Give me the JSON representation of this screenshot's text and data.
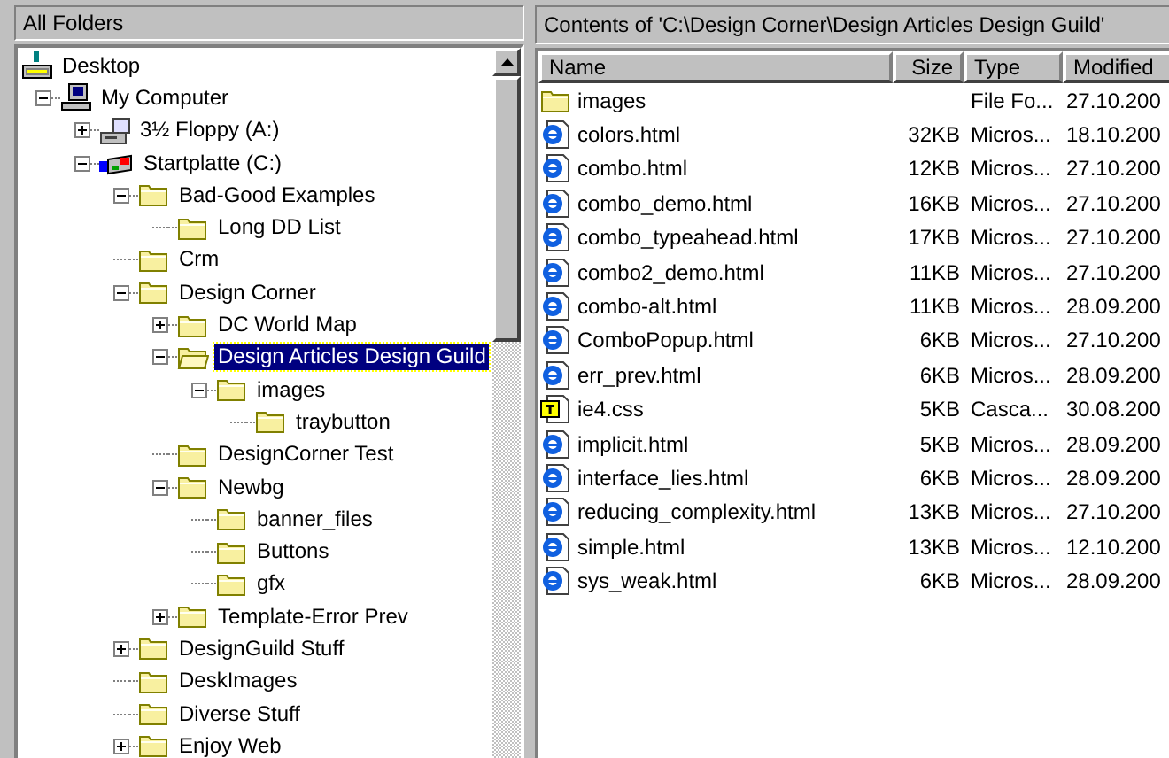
{
  "folders_pane": {
    "title": "All Folders",
    "tree": [
      {
        "label": "Desktop",
        "kind": "desktop",
        "selected": false,
        "children": [
          {
            "label": "My Computer",
            "kind": "computer",
            "selected": false,
            "expanded": true,
            "children": [
              {
                "label": "3½ Floppy (A:)",
                "kind": "floppy",
                "selected": false,
                "expanded": false
              },
              {
                "label": "Startplatte (C:)",
                "kind": "drive",
                "selected": false,
                "expanded": true,
                "children": [
                  {
                    "label": "Bad-Good Examples",
                    "kind": "folder",
                    "selected": false,
                    "expanded": true,
                    "children": [
                      {
                        "label": "Long DD List",
                        "kind": "folder",
                        "selected": false
                      }
                    ]
                  },
                  {
                    "label": "Crm",
                    "kind": "folder",
                    "selected": false
                  },
                  {
                    "label": "Design Corner",
                    "kind": "folder",
                    "selected": false,
                    "expanded": true,
                    "children": [
                      {
                        "label": "DC World Map",
                        "kind": "folder",
                        "selected": false,
                        "expanded": false
                      },
                      {
                        "label": "Design Articles Design Guild",
                        "kind": "folder",
                        "selected": true,
                        "expanded": true,
                        "children": [
                          {
                            "label": "images",
                            "kind": "folder",
                            "selected": false,
                            "expanded": true,
                            "children": [
                              {
                                "label": "traybutton",
                                "kind": "folder",
                                "selected": false
                              }
                            ]
                          }
                        ]
                      },
                      {
                        "label": "DesignCorner Test",
                        "kind": "folder",
                        "selected": false
                      },
                      {
                        "label": "Newbg",
                        "kind": "folder",
                        "selected": false,
                        "expanded": true,
                        "children": [
                          {
                            "label": "banner_files",
                            "kind": "folder",
                            "selected": false
                          },
                          {
                            "label": "Buttons",
                            "kind": "folder",
                            "selected": false
                          },
                          {
                            "label": "gfx",
                            "kind": "folder",
                            "selected": false
                          }
                        ]
                      },
                      {
                        "label": "Template-Error Prev",
                        "kind": "folder",
                        "selected": false,
                        "expanded": false
                      }
                    ]
                  },
                  {
                    "label": "DesignGuild Stuff",
                    "kind": "folder",
                    "selected": false,
                    "expanded": false
                  },
                  {
                    "label": "DeskImages",
                    "kind": "folder",
                    "selected": false
                  },
                  {
                    "label": "Diverse Stuff",
                    "kind": "folder",
                    "selected": false
                  },
                  {
                    "label": "Enjoy Web",
                    "kind": "folder",
                    "selected": false,
                    "expanded": false
                  }
                ]
              }
            ]
          }
        ]
      }
    ]
  },
  "contents_pane": {
    "title": "Contents of 'C:\\Design Corner\\Design Articles Design Guild'",
    "columns": [
      "Name",
      "Size",
      "Type",
      "Modified"
    ],
    "rows": [
      {
        "kind": "folder",
        "name": "images",
        "size": "",
        "type": "File Fo...",
        "modified": "27.10.200"
      },
      {
        "kind": "html",
        "name": "colors.html",
        "size": "32KB",
        "type": "Micros...",
        "modified": "18.10.200"
      },
      {
        "kind": "html",
        "name": "combo.html",
        "size": "12KB",
        "type": "Micros...",
        "modified": "27.10.200"
      },
      {
        "kind": "html",
        "name": "combo_demo.html",
        "size": "16KB",
        "type": "Micros...",
        "modified": "27.10.200"
      },
      {
        "kind": "html",
        "name": "combo_typeahead.html",
        "size": "17KB",
        "type": "Micros...",
        "modified": "27.10.200"
      },
      {
        "kind": "html",
        "name": "combo2_demo.html",
        "size": "11KB",
        "type": "Micros...",
        "modified": "27.10.200"
      },
      {
        "kind": "html",
        "name": "combo-alt.html",
        "size": "11KB",
        "type": "Micros...",
        "modified": "28.09.200"
      },
      {
        "kind": "html",
        "name": "ComboPopup.html",
        "size": "6KB",
        "type": "Micros...",
        "modified": "27.10.200"
      },
      {
        "kind": "html",
        "name": "err_prev.html",
        "size": "6KB",
        "type": "Micros...",
        "modified": "28.09.200"
      },
      {
        "kind": "css",
        "name": "ie4.css",
        "size": "5KB",
        "type": "Casca...",
        "modified": "30.08.200"
      },
      {
        "kind": "html",
        "name": "implicit.html",
        "size": "5KB",
        "type": "Micros...",
        "modified": "28.09.200"
      },
      {
        "kind": "html",
        "name": "interface_lies.html",
        "size": "6KB",
        "type": "Micros...",
        "modified": "28.09.200"
      },
      {
        "kind": "html",
        "name": "reducing_complexity.html",
        "size": "13KB",
        "type": "Micros...",
        "modified": "27.10.200"
      },
      {
        "kind": "html",
        "name": "simple.html",
        "size": "13KB",
        "type": "Micros...",
        "modified": "12.10.200"
      },
      {
        "kind": "html",
        "name": "sys_weak.html",
        "size": "6KB",
        "type": "Micros...",
        "modified": "28.09.200"
      }
    ]
  }
}
